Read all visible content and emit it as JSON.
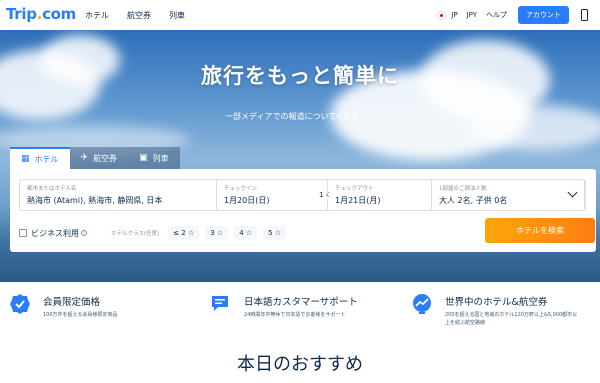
{
  "header": {
    "logo_main": "Trip",
    "logo_dot": ".",
    "logo_tail": "com",
    "nav": [
      "ホテル",
      "航空券",
      "列車"
    ],
    "language": "JP",
    "currency": "JPY",
    "help": "ヘルプ",
    "account": "アカウント"
  },
  "hero": {
    "title": "旅行をもっと簡単に",
    "subtitle": "一部メディアでの報道について<更新>",
    "subtitle_arrow": " >"
  },
  "search": {
    "tabs": [
      {
        "label": "ホテル",
        "icon": "building-icon"
      },
      {
        "label": "航空券",
        "icon": "plane-icon"
      },
      {
        "label": "列車",
        "icon": "train-icon"
      }
    ],
    "destination_label": "都市またはホテル名",
    "destination_value": "熱海市 (Atami), 熱海市, 静岡県, 日本",
    "checkin_label": "チェックイン",
    "checkin_value": "1月20日(日)",
    "nights": "1",
    "checkout_label": "チェックアウト",
    "checkout_value": "1月21日(月)",
    "guests_label": "1部屋のご宿泊人数",
    "guests_value": "大人 2名, 子供 0名",
    "business_label": "ビジネス利用",
    "info_symbol": "i",
    "hotel_class_label": "ホテルクラス(任意)",
    "star_options": [
      "≤ 2 ☆",
      "3 ☆",
      "4 ☆",
      "5 ☆"
    ],
    "search_button": "ホテルを検索"
  },
  "features": [
    {
      "title": "会員限定価格",
      "desc": [
        "100万件を超える会員様限定商品"
      ],
      "icon": "badge-check-icon"
    },
    {
      "title": "日本語カスタマーサポート",
      "desc": [
        "24時間年中無休で日本語でお客様をサポート"
      ],
      "icon": "chat-icon"
    },
    {
      "title": "世界中のホテル&航空券",
      "desc": [
        "200を超える国と地域のホテル120万軒以上&5,000都市以",
        "上を結ぶ航空路線"
      ],
      "icon": "globe-chart-icon"
    }
  ],
  "recommended_title": "本日のおすすめ",
  "colors": {
    "brand": "#287dfa",
    "accent": "#ff8a0d",
    "text": "#0f294d"
  }
}
